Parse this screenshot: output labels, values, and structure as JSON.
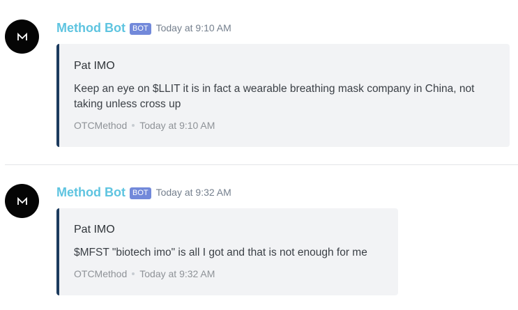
{
  "messages": [
    {
      "author": "Method Bot",
      "badge": "BOT",
      "timestamp": "Today at 9:10 AM",
      "embed": {
        "author": "Pat IMO",
        "description": "Keep an eye on $LLIT it is in fact a wearable breathing mask company in China, not taking unless cross up",
        "footer_text": "OTCMethod",
        "footer_time": "Today at 9:10 AM"
      }
    },
    {
      "author": "Method Bot",
      "badge": "BOT",
      "timestamp": "Today at 9:32 AM",
      "embed": {
        "author": "Pat IMO",
        "description": "$MFST \"biotech imo\" is all I got and that is not enough for me",
        "footer_text": "OTCMethod",
        "footer_time": "Today at 9:32 AM"
      }
    }
  ],
  "colors": {
    "username": "#5ec4e0",
    "bot_badge": "#7289da",
    "embed_border": "#1c3b5e",
    "embed_bg": "#f2f3f5",
    "avatar_bg": "#050505"
  },
  "icons": {
    "avatar": "method-logo-icon"
  }
}
